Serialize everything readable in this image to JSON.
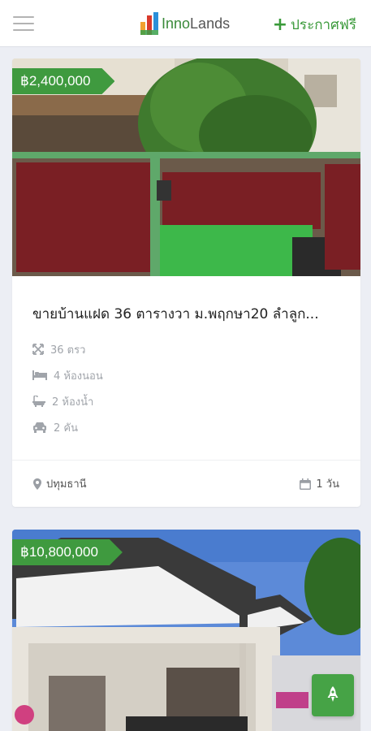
{
  "header": {
    "logo_inno": "Inno",
    "logo_lands": "Lands",
    "post_free_label": "ประกาศฟรี",
    "menu_icon": "hamburger-icon",
    "plus_icon": "plus-icon"
  },
  "colors": {
    "brand_green": "#3f9a3f",
    "background": "#eceef4",
    "muted_text": "#a0a4aa"
  },
  "listings": [
    {
      "price": "฿2,400,000",
      "title": "ขายบ้านแฝด 36 ตารางวา ม.พฤกษา20 ลำลูก...",
      "features": [
        {
          "icon": "expand-icon",
          "text": "36 ตรว"
        },
        {
          "icon": "bed-icon",
          "text": "4 ห้องนอน"
        },
        {
          "icon": "bathtub-icon",
          "text": "2 ห้องน้ำ"
        },
        {
          "icon": "car-icon",
          "text": "2 คัน"
        }
      ],
      "location": "ปทุมธานี",
      "posted": "1 วัน"
    },
    {
      "price": "฿10,800,000"
    }
  ],
  "fab_icon": "rocket-icon"
}
